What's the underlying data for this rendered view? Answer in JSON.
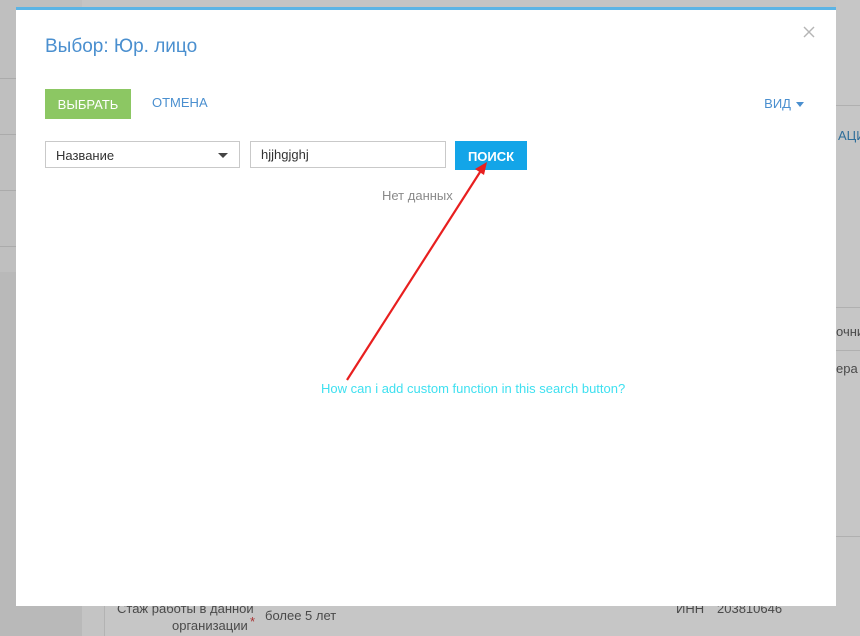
{
  "modal": {
    "title": "Выбор: Юр. лицо",
    "select_label": "ВЫБРАТЬ",
    "cancel_label": "ОТМЕНА",
    "view_label": "ВИД",
    "field_select_value": "Название",
    "search_value": "hjjhgjghj",
    "search_button_label": "ПОИСК",
    "empty_text": "Нет данных"
  },
  "annotation": {
    "text": "How can i add custom function in this search button?",
    "color": "#3fe0f0",
    "arrow_color": "#e81f1f"
  },
  "background": {
    "right_link_fragment": "АЦИ",
    "right_text_1": "очни",
    "right_text_2": "ера",
    "field_label_line1": "Стаж работы в данной",
    "field_label_line2": "организации",
    "required_mark": "*",
    "field_value": "более 5 лет",
    "inn_label": "ИНН",
    "inn_value": "203810646"
  },
  "colors": {
    "accent_blue": "#4a8fcf",
    "select_green": "#8cc763",
    "search_blue": "#13a5e8"
  }
}
